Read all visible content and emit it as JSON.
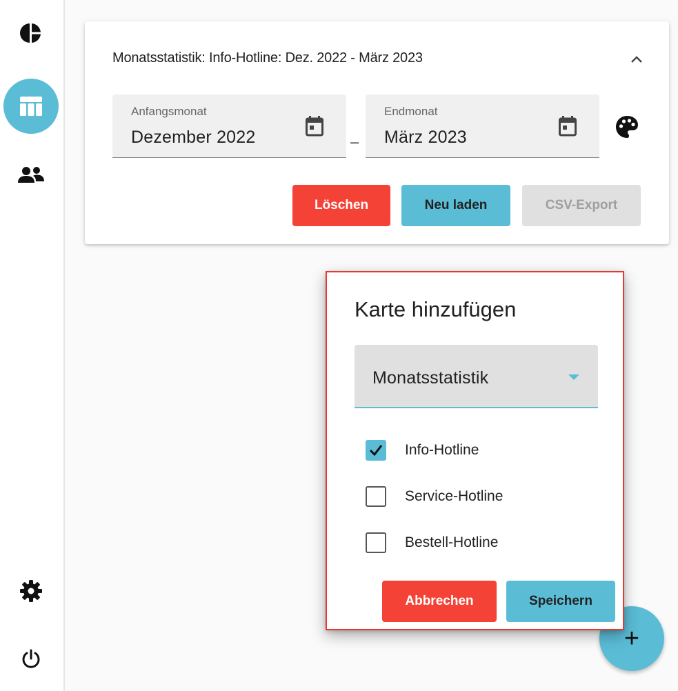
{
  "colors": {
    "accent": "#5bbcd6",
    "danger": "#f44336",
    "disabled": "#e0e0e0",
    "highlight_border": "#e53935"
  },
  "sidebar": {
    "items": [
      {
        "icon": "pie-chart-icon",
        "active": false
      },
      {
        "icon": "table-icon",
        "active": true
      },
      {
        "icon": "people-icon",
        "active": false
      },
      {
        "icon": "gear-icon",
        "active": false
      },
      {
        "icon": "power-icon",
        "active": false
      }
    ]
  },
  "card": {
    "title": "Monatsstatistik: Info-Hotline: Dez. 2022 - März 2023",
    "start_field": {
      "label": "Anfangsmonat",
      "value": "Dezember 2022"
    },
    "separator": "–",
    "end_field": {
      "label": "Endmonat",
      "value": "März 2023"
    },
    "buttons": {
      "delete": "Löschen",
      "reload": "Neu laden",
      "csv_export": "CSV-Export"
    }
  },
  "dialog": {
    "title": "Karte hinzufügen",
    "select_value": "Monatsstatistik",
    "options": [
      {
        "label": "Info-Hotline",
        "checked": true
      },
      {
        "label": "Service-Hotline",
        "checked": false
      },
      {
        "label": "Bestell-Hotline",
        "checked": false
      }
    ],
    "cancel_label": "Abbrechen",
    "save_label": "Speichern"
  },
  "fab": {
    "label": "+",
    "icon": "plus-icon"
  }
}
